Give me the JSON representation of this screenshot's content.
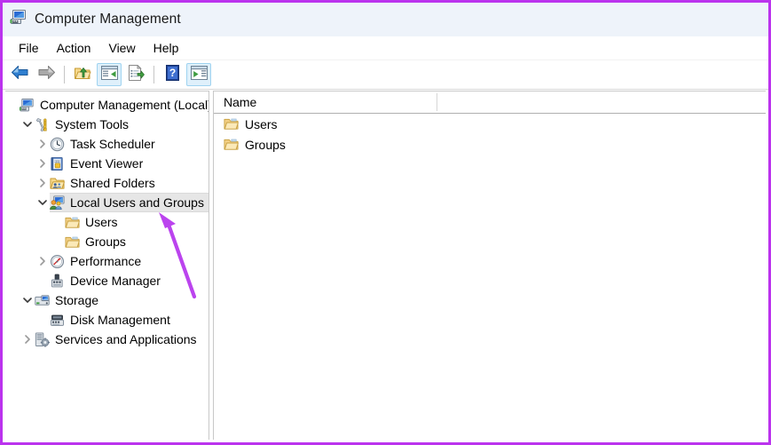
{
  "window": {
    "title": "Computer Management",
    "icon": "computer-management-icon",
    "border_color": "#bb33ee",
    "titlebar_bg": "#eef3fa"
  },
  "menubar": {
    "items": [
      {
        "label": "File",
        "name": "menu-file"
      },
      {
        "label": "Action",
        "name": "menu-action"
      },
      {
        "label": "View",
        "name": "menu-view"
      },
      {
        "label": "Help",
        "name": "menu-help"
      }
    ]
  },
  "toolbar": {
    "buttons": [
      {
        "name": "back-button",
        "icon": "back-arrow-icon",
        "framed": false
      },
      {
        "name": "forward-button",
        "icon": "forward-arrow-icon",
        "framed": false
      },
      {
        "name": "separator-1",
        "icon": "separator",
        "framed": false
      },
      {
        "name": "up-one-level-button",
        "icon": "folder-up-icon",
        "framed": false
      },
      {
        "name": "show-hide-console-tree-button",
        "icon": "console-tree-icon",
        "framed": true
      },
      {
        "name": "export-list-button",
        "icon": "export-list-icon",
        "framed": false
      },
      {
        "name": "separator-2",
        "icon": "separator",
        "framed": false
      },
      {
        "name": "help-button",
        "icon": "help-question-icon",
        "framed": false
      },
      {
        "name": "show-action-pane-button",
        "icon": "action-pane-icon",
        "framed": true
      }
    ]
  },
  "tree": {
    "items": [
      {
        "label": "Computer Management (Local)",
        "indent": 0,
        "twisty": "none",
        "icon": "computer-icon",
        "selected": false,
        "name": "tree-item-computer-management-local"
      },
      {
        "label": "System Tools",
        "indent": 1,
        "twisty": "expanded",
        "icon": "system-tools-icon",
        "selected": false,
        "name": "tree-item-system-tools"
      },
      {
        "label": "Task Scheduler",
        "indent": 2,
        "twisty": "collapsed",
        "icon": "clock-icon",
        "selected": false,
        "name": "tree-item-task-scheduler"
      },
      {
        "label": "Event Viewer",
        "indent": 2,
        "twisty": "collapsed",
        "icon": "event-viewer-icon",
        "selected": false,
        "name": "tree-item-event-viewer"
      },
      {
        "label": "Shared Folders",
        "indent": 2,
        "twisty": "collapsed",
        "icon": "shared-folders-icon",
        "selected": false,
        "name": "tree-item-shared-folders"
      },
      {
        "label": "Local Users and Groups",
        "indent": 2,
        "twisty": "expanded",
        "icon": "local-users-groups-icon",
        "selected": true,
        "name": "tree-item-local-users-and-groups"
      },
      {
        "label": "Users",
        "indent": 3,
        "twisty": "none",
        "icon": "folder-icon",
        "selected": false,
        "name": "tree-item-users"
      },
      {
        "label": "Groups",
        "indent": 3,
        "twisty": "none",
        "icon": "folder-icon",
        "selected": false,
        "name": "tree-item-groups"
      },
      {
        "label": "Performance",
        "indent": 2,
        "twisty": "collapsed",
        "icon": "performance-icon",
        "selected": false,
        "name": "tree-item-performance"
      },
      {
        "label": "Device Manager",
        "indent": 2,
        "twisty": "none",
        "icon": "device-manager-icon",
        "selected": false,
        "name": "tree-item-device-manager"
      },
      {
        "label": "Storage",
        "indent": 1,
        "twisty": "expanded",
        "icon": "storage-icon",
        "selected": false,
        "name": "tree-item-storage"
      },
      {
        "label": "Disk Management",
        "indent": 2,
        "twisty": "none",
        "icon": "disk-management-icon",
        "selected": false,
        "name": "tree-item-disk-management"
      },
      {
        "label": "Services and Applications",
        "indent": 1,
        "twisty": "collapsed",
        "icon": "services-apps-icon",
        "selected": false,
        "name": "tree-item-services-and-applications"
      }
    ]
  },
  "list": {
    "columns": [
      {
        "label": "Name",
        "name": "column-header-name"
      }
    ],
    "rows": [
      {
        "label": "Users",
        "icon": "folder-icon",
        "name": "list-item-users"
      },
      {
        "label": "Groups",
        "icon": "folder-icon",
        "name": "list-item-groups"
      }
    ]
  },
  "annotation": {
    "arrow_color": "#bb44ee",
    "points_to": "Local Users and Groups"
  }
}
